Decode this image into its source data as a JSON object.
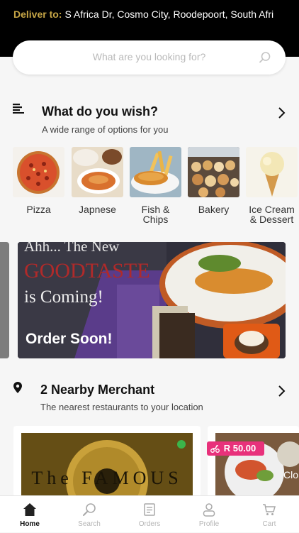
{
  "header": {
    "deliver_label": "Deliver to:",
    "address": "S Africa Dr, Cosmo City, Roodepoort, South Afri"
  },
  "search": {
    "placeholder": "What are you looking for?"
  },
  "wish_section": {
    "title": "What do you wish?",
    "subtitle": "A wide range of options for you"
  },
  "categories": [
    {
      "line1": "Pizza",
      "line2": ""
    },
    {
      "line1": "Japnese",
      "line2": ""
    },
    {
      "line1": "Fish &",
      "line2": "Chips"
    },
    {
      "line1": "Bakery",
      "line2": ""
    },
    {
      "line1": "Ice Cream",
      "line2": "& Dessert"
    }
  ],
  "banner": {
    "line1": "Ahh... The New",
    "line2": "GOODTASTE",
    "line3": "is Coming!",
    "cta": "Order Soon!"
  },
  "nearby_section": {
    "title": "2 Nearby Merchant",
    "subtitle": "The nearest restaurants to your location"
  },
  "merchants": [
    {
      "logo_text": "The FAMOUS"
    },
    {
      "price": "R 50.00",
      "partial_text": "Clo"
    }
  ],
  "tabs": [
    {
      "label": "Home",
      "icon": "home-icon",
      "active": true
    },
    {
      "label": "Search",
      "icon": "search-icon",
      "active": false
    },
    {
      "label": "Orders",
      "icon": "orders-icon",
      "active": false
    },
    {
      "label": "Profile",
      "icon": "profile-icon",
      "active": false
    },
    {
      "label": "Cart",
      "icon": "cart-icon",
      "active": false
    }
  ],
  "colors": {
    "accent_gold": "#c7a646",
    "price_badge": "#e8317b",
    "top_bar": "#000000"
  }
}
